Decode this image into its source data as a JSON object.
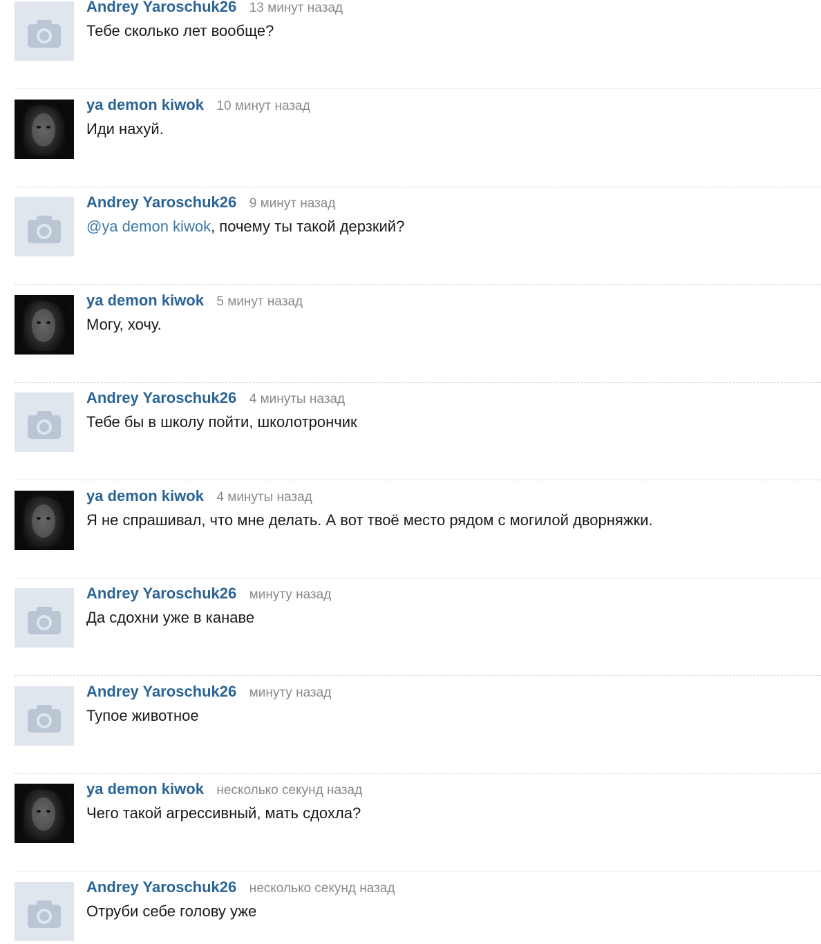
{
  "comments": [
    {
      "author": "Andrey Yaroschuk26",
      "time": "13 минут назад",
      "text": "Тебе сколько лет вообще?"
    },
    {
      "author": "ya demon kiwok",
      "time": "10 минут назад",
      "text": "Иди нахуй."
    },
    {
      "author": "Andrey Yaroschuk26",
      "time": "9 минут назад",
      "mention": "@ya demon kiwok",
      "text": ", почему ты такой дерзкий?"
    },
    {
      "author": "ya demon kiwok",
      "time": "5 минут назад",
      "text": "Могу, хочу."
    },
    {
      "author": "Andrey Yaroschuk26",
      "time": "4 минуты назад",
      "text": "Тебе бы в школу пойти, школотрончик"
    },
    {
      "author": "ya demon kiwok",
      "time": "4 минуты назад",
      "text": "Я не спрашивал, что мне делать. А вот твоё место рядом с могилой дворняжки."
    },
    {
      "author": "Andrey Yaroschuk26",
      "time": "минуту назад",
      "text": "Да сдохни уже в канаве"
    },
    {
      "author": "Andrey Yaroschuk26",
      "time": "минуту назад",
      "text": "Тупое животное"
    },
    {
      "author": "ya demon kiwok",
      "time": "несколько секунд назад",
      "text": "Чего такой агрессивный, мать сдохла?"
    },
    {
      "author": "Andrey Yaroschuk26",
      "time": "несколько секунд назад",
      "text": "Отруби себе голову уже"
    }
  ],
  "colors": {
    "author_link": "#2a6496",
    "mention_link": "#3d79a8",
    "timestamp": "#8a8a8a",
    "message_text": "#1a1a1a",
    "placeholder_bg": "#e0e6ed",
    "placeholder_icon": "#bac6d4",
    "divider": "#dbdbdb"
  },
  "icons": {
    "placeholder_avatar": "camera-icon"
  }
}
